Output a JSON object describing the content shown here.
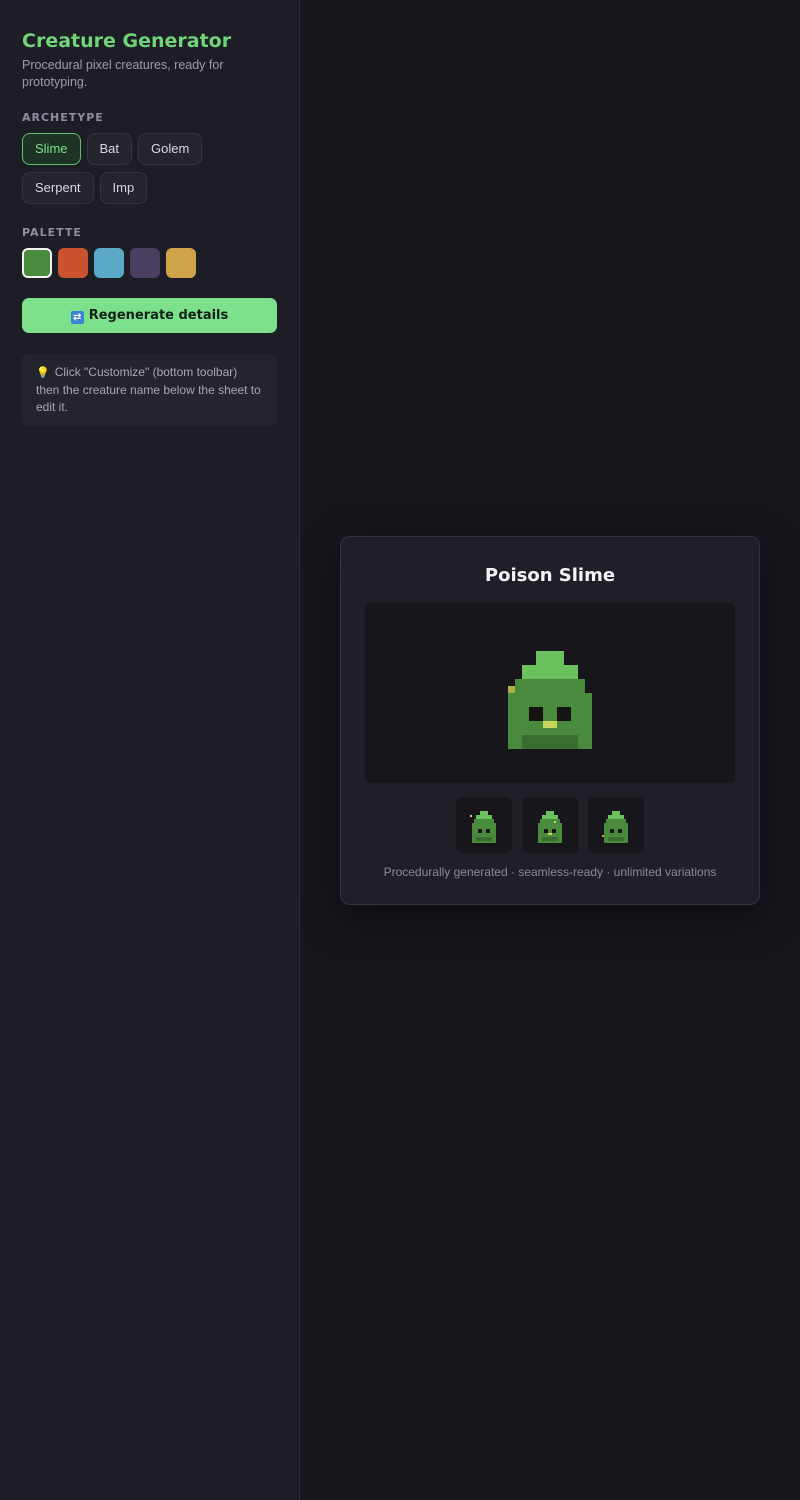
{
  "sidebar": {
    "title": "Creature Generator",
    "subtitle": "Procedural pixel creatures, ready for prototyping.",
    "archetype_label": "ARCHETYPE",
    "archetypes": [
      {
        "label": "Slime",
        "active": true
      },
      {
        "label": "Bat",
        "active": false
      },
      {
        "label": "Golem",
        "active": false
      },
      {
        "label": "Serpent",
        "active": false
      },
      {
        "label": "Imp",
        "active": false
      }
    ],
    "palette_label": "PALETTE",
    "palette": [
      {
        "color": "#4a8a3c",
        "active": true
      },
      {
        "color": "#c9532f",
        "active": false
      },
      {
        "color": "#5aa9c8",
        "active": false
      },
      {
        "color": "#4a3f60",
        "active": false
      },
      {
        "color": "#d0a24a",
        "active": false
      }
    ],
    "regenerate_label": "Regenerate details",
    "regenerate_icon": "shuffle-icon",
    "tip_icon": "lightbulb-icon",
    "tip_text": "Click \"Customize\" (bottom toolbar) then the creature name below the sheet to edit it."
  },
  "sheet": {
    "creature_name": "Poison Slime",
    "footnote": "Procedurally generated · seamless-ready · unlimited variations",
    "variation_count": 3
  },
  "colors": {
    "accent": "#7de08a",
    "slime_light": "#6cc15f",
    "slime_body": "#4a8a3c",
    "slime_dark": "#3a6e31",
    "eye": "#141414",
    "mouth": "#c8d45a",
    "spot": "#b0b040"
  }
}
